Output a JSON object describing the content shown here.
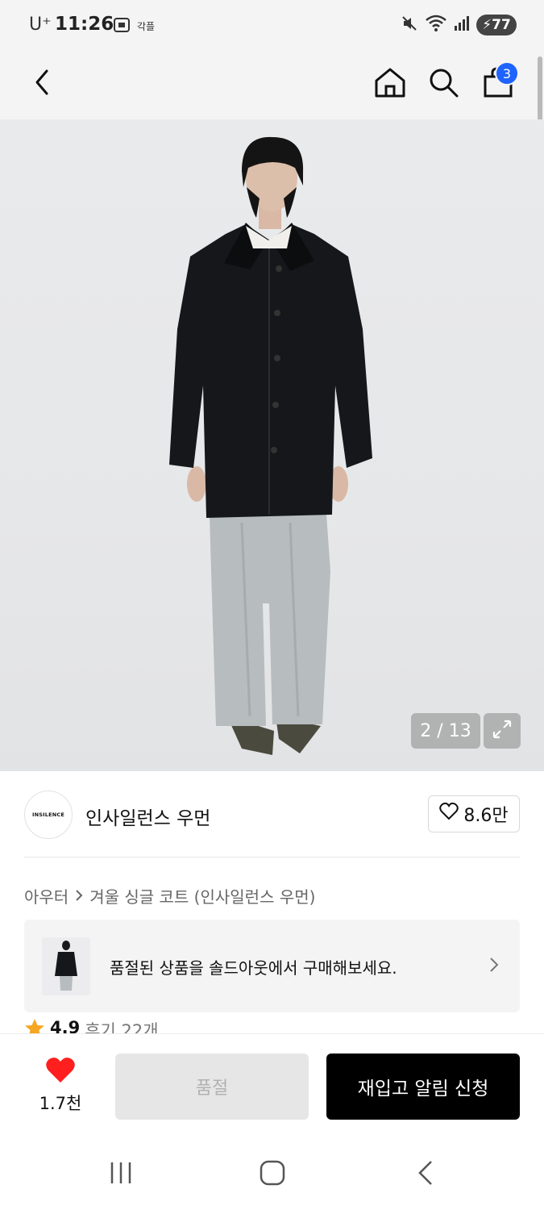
{
  "status_bar": {
    "carrier": "U⁺",
    "time": "11:26",
    "extra_label": "각플",
    "battery": "77",
    "icons": [
      "screenshot-icon",
      "mute-icon",
      "wifi-icon",
      "signal-icon",
      "battery-icon"
    ]
  },
  "header": {
    "cart_count": "3",
    "icons": [
      "back-icon",
      "home-icon",
      "search-icon",
      "cart-icon"
    ]
  },
  "gallery": {
    "counter": "2 / 13"
  },
  "brand": {
    "logo_text": "INSILENCE",
    "name": "인사일런스 우먼",
    "like_count": "8.6만"
  },
  "breadcrumb": {
    "category": "아우터",
    "product": "겨울 싱글 코트 (인사일런스 우먼)"
  },
  "soldout_banner": {
    "text": "품절된 상품을 솔드아웃에서 구매해보세요."
  },
  "rating": {
    "score": "4.9",
    "reviews": "후기 22개"
  },
  "bottom_bar": {
    "like_count": "1.7천",
    "soldout_label": "품절",
    "restock_label": "재입고 알림 신청"
  },
  "colors": {
    "accent_blue": "#1e63ff",
    "heart_red": "#ff1f1f",
    "star_orange": "#f5a623",
    "primary_black": "#000000"
  }
}
